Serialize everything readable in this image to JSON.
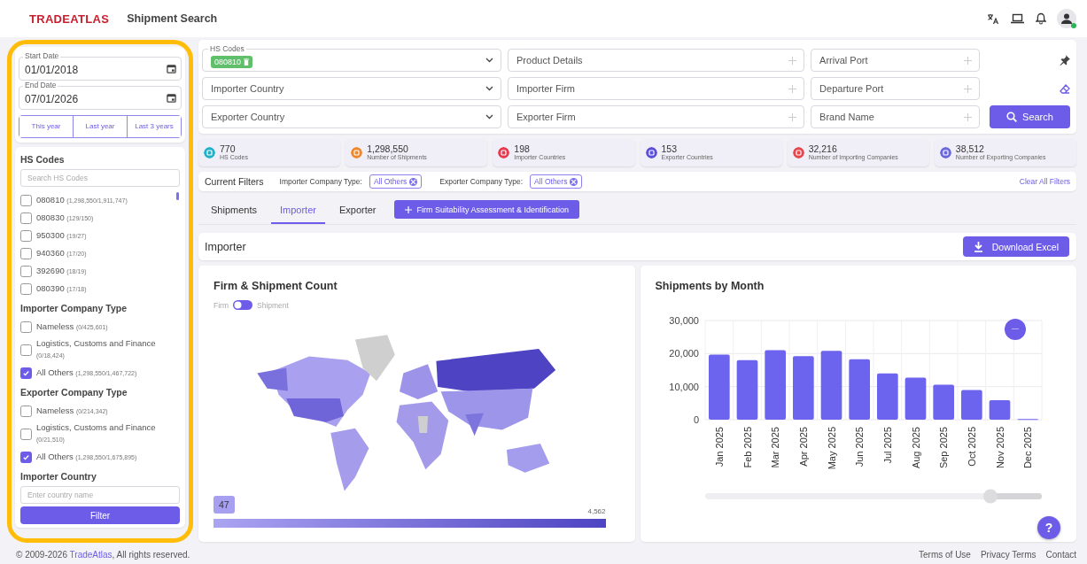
{
  "header": {
    "logo": "TRADEATLAS",
    "title": "Shipment Search"
  },
  "sidebar": {
    "start_date": {
      "label": "Start Date",
      "value": "01/01/2018"
    },
    "end_date": {
      "label": "End Date",
      "value": "07/01/2026"
    },
    "date_presets": [
      "This year",
      "Last year",
      "Last 3 years"
    ],
    "hs_codes": {
      "title": "HS Codes",
      "placeholder": "Search HS Codes",
      "items": [
        {
          "code": "080810",
          "count": "(1,298,550/1,911,747)",
          "checked": false
        },
        {
          "code": "080830",
          "count": "(129/150)",
          "checked": false
        },
        {
          "code": "950300",
          "count": "(19/27)",
          "checked": false
        },
        {
          "code": "940360",
          "count": "(17/20)",
          "checked": false
        },
        {
          "code": "392690",
          "count": "(18/19)",
          "checked": false
        },
        {
          "code": "080390",
          "count": "(17/18)",
          "checked": false
        }
      ]
    },
    "company_types": [
      {
        "title": "Importer Company Type",
        "items": [
          {
            "label": "Nameless",
            "count": "(0/425,601)",
            "checked": false
          },
          {
            "label": "Logistics, Customs and Finance",
            "count": "(0/18,424)",
            "checked": false
          },
          {
            "label": "All Others",
            "count": "(1,298,550/1,467,722)",
            "checked": true
          }
        ]
      },
      {
        "title": "Exporter Company Type",
        "items": [
          {
            "label": "Nameless",
            "count": "(0/214,342)",
            "checked": false
          },
          {
            "label": "Logistics, Customs and Finance",
            "count": "(0/21,510)",
            "checked": false
          },
          {
            "label": "All Others",
            "count": "(1,298,550/1,675,895)",
            "checked": true
          }
        ]
      }
    ],
    "importer_country": {
      "title": "Importer Country",
      "placeholder": "Enter country name"
    },
    "filter_button": "Filter"
  },
  "search_form": {
    "rows": [
      [
        {
          "kind": "chips",
          "label": "HS Codes",
          "chips": [
            "080810"
          ]
        },
        {
          "kind": "text",
          "placeholder": "Product Details"
        },
        {
          "kind": "text",
          "placeholder": "Arrival Port"
        }
      ],
      [
        {
          "kind": "dropdown",
          "label": "Importer Country"
        },
        {
          "kind": "text",
          "placeholder": "Importer Firm"
        },
        {
          "kind": "text",
          "placeholder": "Departure Port"
        }
      ],
      [
        {
          "kind": "dropdown",
          "label": "Exporter Country"
        },
        {
          "kind": "text",
          "placeholder": "Exporter Firm"
        },
        {
          "kind": "text",
          "placeholder": "Brand Name"
        }
      ]
    ],
    "search_button": "Search"
  },
  "stats": [
    {
      "value": "770",
      "label": "HS Codes",
      "color": "#1fb3c9"
    },
    {
      "value": "1,298,550",
      "label": "Number of Shipments",
      "color": "#f0882a"
    },
    {
      "value": "198",
      "label": "Importer Countries",
      "color": "#e8394f"
    },
    {
      "value": "153",
      "label": "Exporter Countries",
      "color": "#5a4fd8"
    },
    {
      "value": "32,216",
      "label": "Number of Importing Companies",
      "color": "#e5474f"
    },
    {
      "value": "38,512",
      "label": "Number of Exporting Companies",
      "color": "#6a68dc"
    }
  ],
  "current_filters": {
    "title": "Current Filters",
    "filters": [
      {
        "label": "Importer Company Type:",
        "value": "All Others"
      },
      {
        "label": "Exporter Company Type:",
        "value": "All Others"
      }
    ],
    "clear": "Clear All Filters"
  },
  "tabs": [
    {
      "label": "Shipments",
      "selected": false
    },
    {
      "label": "Importer",
      "selected": true
    },
    {
      "label": "Exporter",
      "selected": false
    }
  ],
  "assessment_button": "Firm Suitability Assessment & Identification",
  "section": {
    "title": "Importer",
    "download_button": "Download Excel"
  },
  "map_panel": {
    "title": "Firm & Shipment Count",
    "toggle_left": "Firm",
    "toggle_on": true,
    "toggle_right": "Shipment",
    "scale_min": "47",
    "scale_max": "4,562"
  },
  "chart_panel": {
    "title": "Shipments by Month",
    "help_button": "?",
    "chart_data": {
      "type": "bar",
      "categories": [
        "Jan 2025",
        "Feb 2025",
        "Mar 2025",
        "Apr 2025",
        "May 2025",
        "Jun 2025",
        "Jul 2025",
        "Aug 2025",
        "Sep 2025",
        "Oct 2025",
        "Nov 2025",
        "Dec 2025"
      ],
      "series": [
        {
          "color": "#6c63ee",
          "values": [
            19700,
            18000,
            21000,
            19200,
            20800,
            18300,
            14000,
            12700,
            10600,
            9000,
            5900,
            200
          ]
        }
      ],
      "ylim": [
        0,
        30000
      ],
      "yticks": [
        {
          "value": 0,
          "label": "0"
        },
        {
          "value": 10000,
          "label": "10,000"
        },
        {
          "value": 20000,
          "label": "20,000"
        },
        {
          "value": 30000,
          "label": "30,000"
        }
      ]
    }
  },
  "footer": {
    "copyright_before": "© 2009-2026 ",
    "copyright_link": "TradeAtlas",
    "copyright_after": ", All rights reserved.",
    "links": [
      "Terms of Use",
      "Privacy Terms",
      "Contact"
    ]
  }
}
